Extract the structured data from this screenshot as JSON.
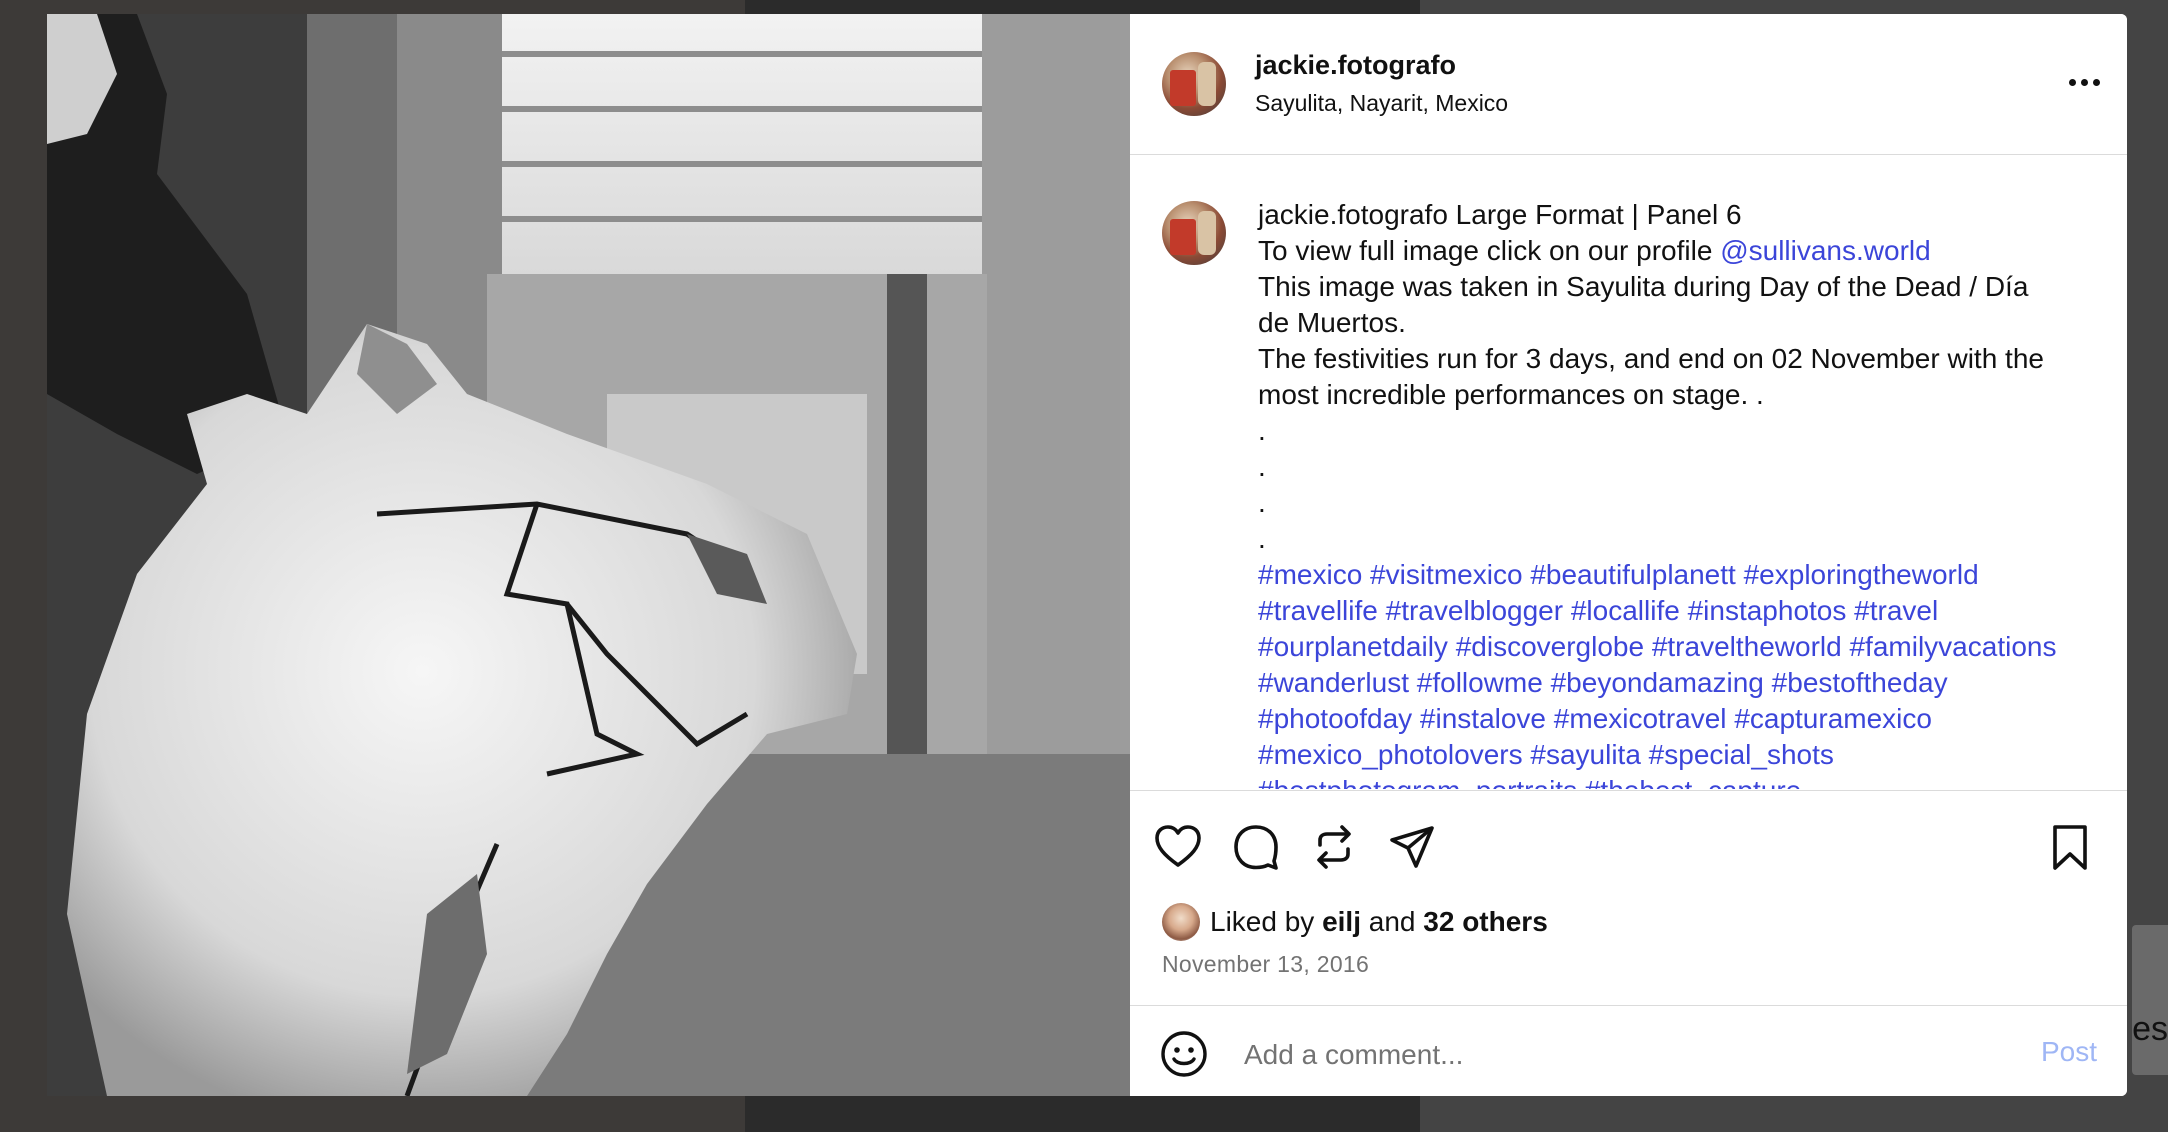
{
  "header": {
    "username": "jackie.fotografo",
    "location": "Sayulita, Nayarit, Mexico",
    "avatar_icon": "profile-photo",
    "more_icon": "more-horizontal-icon"
  },
  "caption": {
    "username": "jackie.fotografo",
    "title": "Large Format | Panel 6",
    "line2_text": "To view full image click on our profile",
    "mention": "@sullivans.world",
    "line3": "This image was taken in Sayulita during Day of the Dead / Día de Muertos.",
    "line4": "The festivities run for 3 days, and end on 02 November with the most incredible performances on stage. .",
    "dots": [
      ".",
      ".",
      ".",
      "."
    ],
    "hashtags": [
      "#mexico",
      "#visitmexico",
      "#beautifulplanett",
      "#exploringtheworld",
      "#travellife",
      "#travelblogger",
      "#locallife",
      "#instaphotos",
      "#travel",
      "#ourplanetdaily",
      "#discoverglobe",
      "#traveltheworld",
      "#familyvacations",
      "#wanderlust",
      "#followme",
      "#beyondamazing",
      "#bestoftheday",
      "#photoofday",
      "#instalove",
      "#mexicotravel",
      "#capturamexico",
      "#mexico_photolovers",
      "#sayulita",
      "#special_shots",
      "#bestphotogram_portraits",
      "#thebest_capture"
    ]
  },
  "actions": {
    "like_icon": "heart-icon",
    "comment_icon": "comment-icon",
    "repost_icon": "repost-icon",
    "share_icon": "share-icon",
    "save_icon": "bookmark-icon"
  },
  "likes": {
    "prefix": "Liked by",
    "user": "eilj",
    "middle": "and",
    "others": "32 others"
  },
  "date": "November 13, 2016",
  "comment": {
    "placeholder": "Add a comment...",
    "post_label": "Post",
    "emoji_icon": "emoji-smile-icon"
  },
  "background": {
    "partial_text": "es"
  },
  "colors": {
    "link": "#3b45d9",
    "post_disabled": "#9fb6f5",
    "muted": "#737373",
    "divider": "#dbdbdb"
  }
}
